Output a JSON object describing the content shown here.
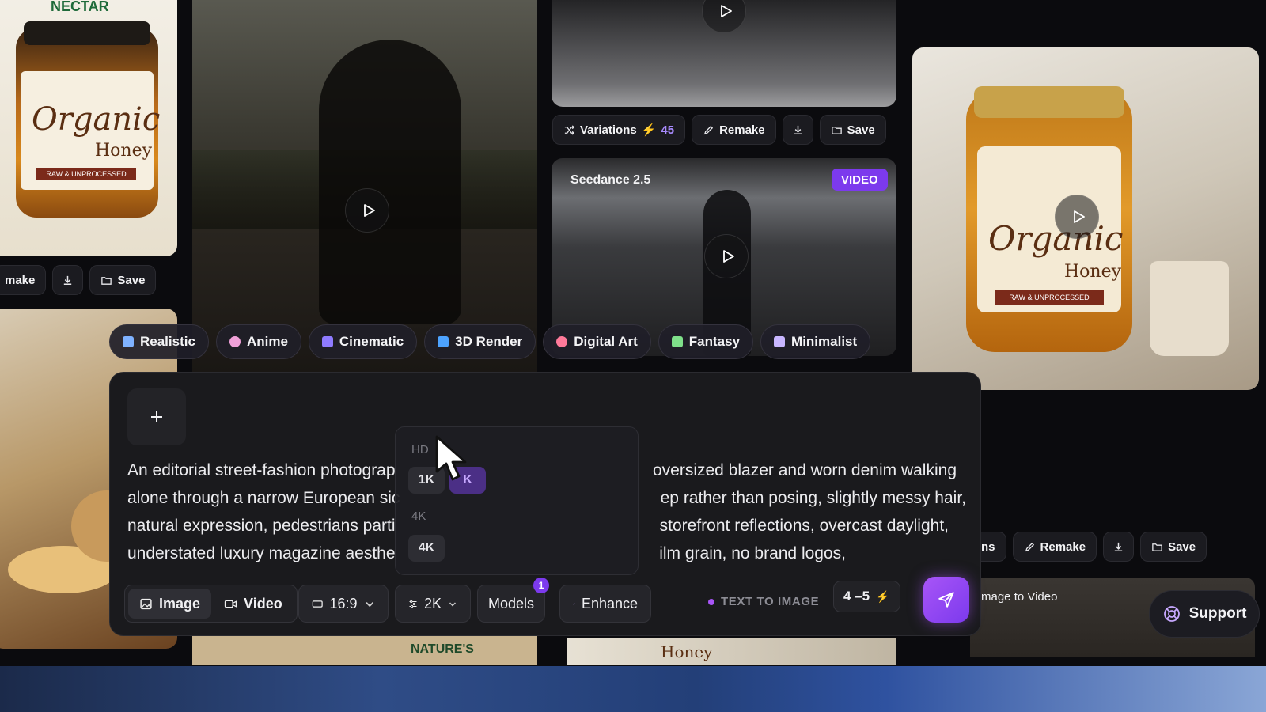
{
  "theme": {
    "accent": "#a855f7",
    "accent_dark": "#7c3aed",
    "video_badge": "#7c3aed"
  },
  "gallery": {
    "tile_left_top": {
      "brand_top": "NECTAR",
      "brand": "NATURE'S NECTAR",
      "jar_title": "Organic",
      "jar_sub": "Honey",
      "jar_band": "RAW & UNPROCESSED"
    },
    "tile_left_actions": {
      "remake": "make",
      "save": "Save"
    },
    "tile_top_center_actions": {
      "variations": "Variations",
      "variations_count": "45",
      "remake": "Remake",
      "save": "Save"
    },
    "seedance": {
      "model": "Seedance 2.5",
      "badge": "VIDEO"
    },
    "tile_right": {
      "jar_title": "Organic",
      "jar_sub": "Honey",
      "jar_band": "RAW & UNPROCESSED"
    },
    "tile_right_actions": {
      "partial": "ns",
      "remake": "Remake",
      "save": "Save"
    },
    "image_to_video": "mage to Video",
    "bottom_peek_left": "NATURE'S",
    "bottom_peek_center": "Honey"
  },
  "styles": [
    {
      "label": "Realistic",
      "color": "#7fb2ff"
    },
    {
      "label": "Anime",
      "color": "#f0a0d8"
    },
    {
      "label": "Cinematic",
      "color": "#8f7bff"
    },
    {
      "label": "3D Render",
      "color": "#4da3ff"
    },
    {
      "label": "Digital Art",
      "color": "#ff7a9a"
    },
    {
      "label": "Fantasy",
      "color": "#7fe08a"
    },
    {
      "label": "Minimalist",
      "color": "#c8b6ff"
    }
  ],
  "composer": {
    "prompt_lines": [
      "An editorial street-fashion photograp",
      "alone through a narrow European sic",
      "natural expression, pedestrians parti",
      "understated luxury magazine aesthe"
    ],
    "prompt_lines_right": [
      "oversized blazer and worn denim walking",
      "ep rather than posing, slightly messy hair,",
      "storefront reflections, overcast daylight,",
      "ilm grain, no brand logos,"
    ],
    "resolution_menu": {
      "head_hd": "HD",
      "opt_1k": "1K",
      "opt_2k_partial": "K",
      "head_4k": "4K",
      "opt_4k": "4K"
    },
    "toolbar": {
      "image": "Image",
      "video": "Video",
      "aspect": "16:9",
      "resolution": "2K",
      "models": "Models",
      "models_badge": "1",
      "enhance": "Enhance",
      "mode": "TEXT TO IMAGE",
      "credits": "4 –5"
    }
  },
  "support": "Support"
}
